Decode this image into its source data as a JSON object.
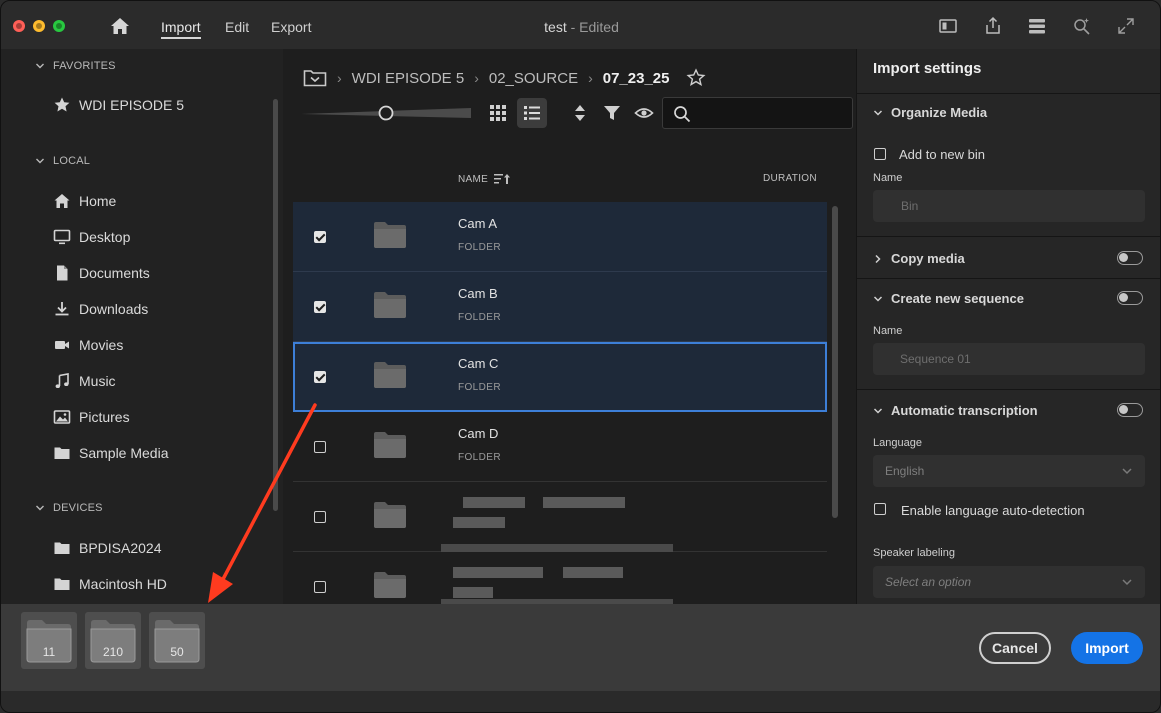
{
  "window": {
    "title": "test",
    "title_suffix": "- Edited"
  },
  "menu": {
    "home_icon": "home-icon",
    "items": [
      "Import",
      "Edit",
      "Export"
    ],
    "active": "Import"
  },
  "toolbar_icons": [
    "panel-icon",
    "share-icon",
    "queue-icon",
    "search-spark-icon",
    "fullscreen-icon"
  ],
  "sidebar": {
    "favorites_label": "FAVORITES",
    "favorites": [
      {
        "label": "WDI EPISODE 5",
        "icon": "star-icon"
      }
    ],
    "local_label": "LOCAL",
    "local": [
      {
        "label": "Home",
        "icon": "home-icon"
      },
      {
        "label": "Desktop",
        "icon": "monitor-icon"
      },
      {
        "label": "Documents",
        "icon": "document-icon"
      },
      {
        "label": "Downloads",
        "icon": "download-icon"
      },
      {
        "label": "Movies",
        "icon": "video-icon"
      },
      {
        "label": "Music",
        "icon": "music-icon"
      },
      {
        "label": "Pictures",
        "icon": "image-icon"
      },
      {
        "label": "Sample Media",
        "icon": "folder-icon"
      }
    ],
    "devices_label": "DEVICES",
    "devices": [
      {
        "label": "BPDISA2024",
        "icon": "folder-icon"
      },
      {
        "label": "Macintosh HD",
        "icon": "folder-icon"
      }
    ]
  },
  "browser": {
    "breadcrumb": [
      "WDI EPISODE 5",
      "02_SOURCE",
      "07_23_25"
    ],
    "search_placeholder": "",
    "columns": {
      "name": "NAME",
      "duration": "DURATION"
    },
    "rows": [
      {
        "name": "Cam A",
        "type": "FOLDER",
        "checked": true
      },
      {
        "name": "Cam B",
        "type": "FOLDER",
        "checked": true
      },
      {
        "name": "Cam C",
        "type": "FOLDER",
        "checked": true
      },
      {
        "name": "Cam D",
        "type": "FOLDER",
        "checked": false
      },
      {
        "name": "",
        "type": "",
        "checked": false
      },
      {
        "name": "",
        "type": "",
        "checked": false
      }
    ]
  },
  "settings": {
    "title": "Import settings",
    "organize": {
      "label": "Organize Media",
      "checkbox": "Add to new bin",
      "field_label": "Name",
      "field_value": "Bin"
    },
    "copy": {
      "label": "Copy media"
    },
    "sequence": {
      "label": "Create new sequence",
      "field_label": "Name",
      "field_value": "Sequence 01"
    },
    "transcription": {
      "label": "Automatic transcription",
      "language_label": "Language",
      "language_value": "English",
      "auto_detect": "Enable language auto-detection",
      "speaker_label": "Speaker labeling",
      "speaker_value": "Select an option"
    }
  },
  "bottom": {
    "stacks": [
      "11",
      "210",
      "50"
    ],
    "cancel": "Cancel",
    "import": "Import"
  },
  "colors": {
    "accent": "#1473e6",
    "selection": "#1e2939",
    "focus": "#3d7fd8",
    "annotation_arrow": "#ff3b1f"
  }
}
